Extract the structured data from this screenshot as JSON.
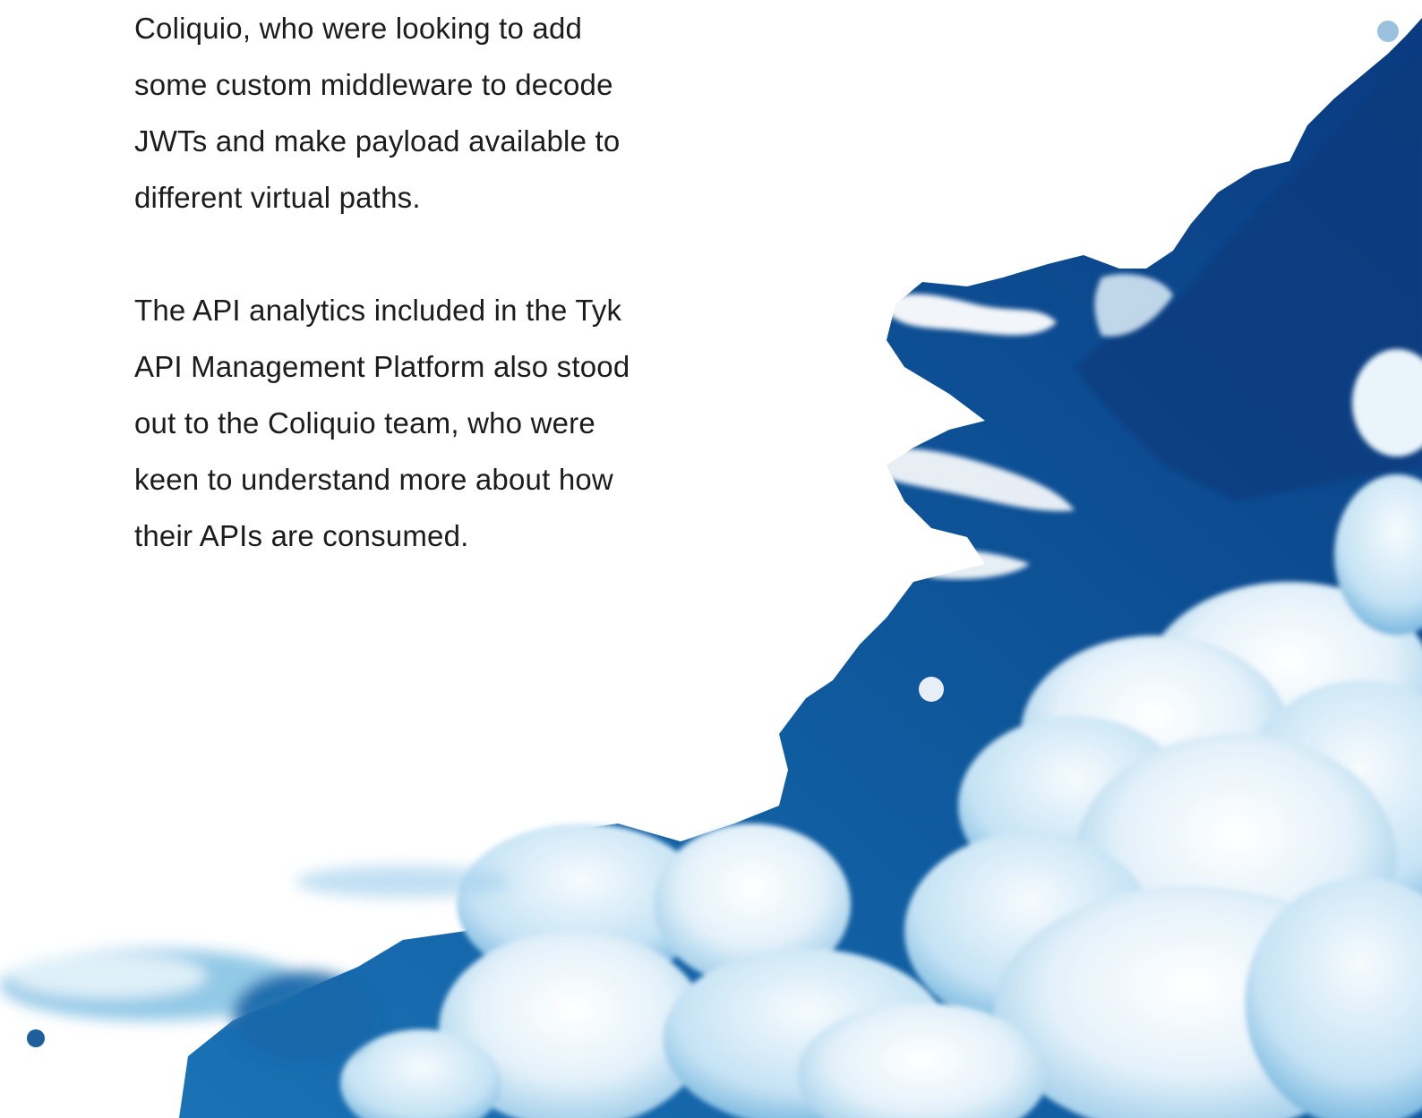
{
  "article": {
    "paragraphs": [
      {
        "lines": [
          "Coliquio, who were looking to add",
          "some custom middleware to decode",
          "JWTs and make payload available to",
          "different virtual paths."
        ]
      },
      {
        "lines": [
          "The API analytics included in the Tyk",
          "API Management Platform also stood",
          "out to the Coliquio team, who were",
          "keen to understand more about how",
          "their APIs are consumed."
        ]
      }
    ]
  },
  "illustration": {
    "name": "watercolor-sky-clouds",
    "colors": {
      "deep_blue": "#0b3f86",
      "mid_blue": "#1466a8",
      "light_blue": "#7fbfe3",
      "cloud_white": "#f4f9fd",
      "cloud_shadow": "#b9dcf0"
    }
  }
}
